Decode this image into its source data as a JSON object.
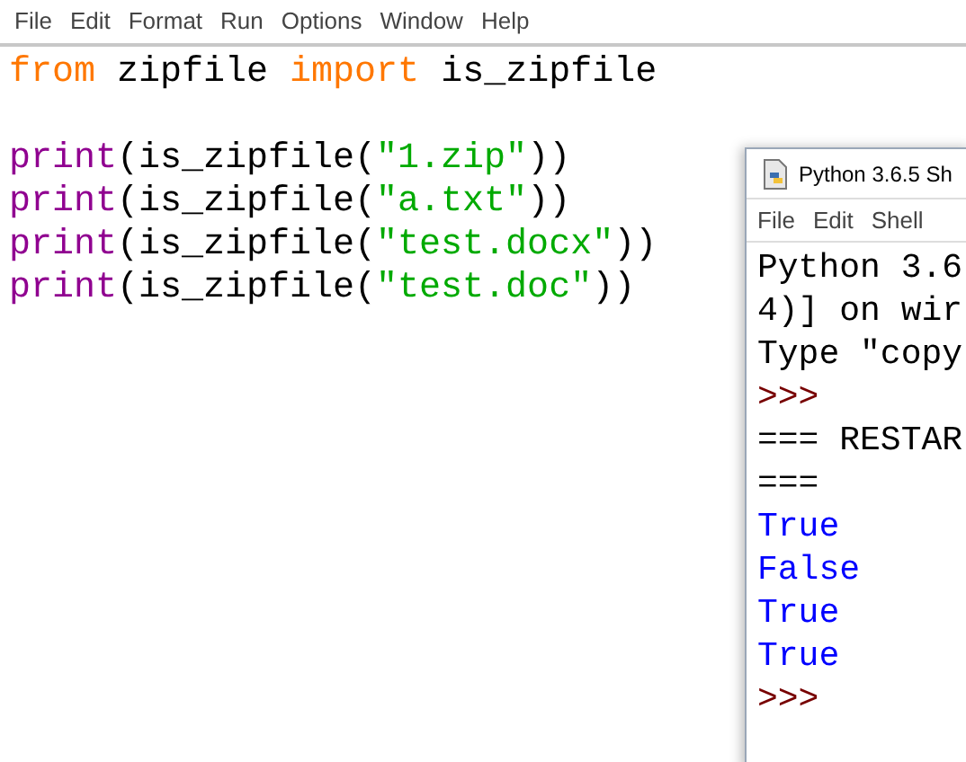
{
  "editor": {
    "menu": [
      "File",
      "Edit",
      "Format",
      "Run",
      "Options",
      "Window",
      "Help"
    ],
    "lines": [
      [
        {
          "kind": "keyword",
          "text": "from"
        },
        {
          "kind": "plain",
          "text": " zipfile "
        },
        {
          "kind": "keyword",
          "text": "import"
        },
        {
          "kind": "plain",
          "text": " is_zipfile"
        },
        {
          "kind": "blank_after"
        }
      ],
      [
        {
          "kind": "builtin",
          "text": "print"
        },
        {
          "kind": "plain",
          "text": "(is_zipfile("
        },
        {
          "kind": "string",
          "text": "\"1.zip\""
        },
        {
          "kind": "plain",
          "text": "))"
        }
      ],
      [
        {
          "kind": "builtin",
          "text": "print"
        },
        {
          "kind": "plain",
          "text": "(is_zipfile("
        },
        {
          "kind": "string",
          "text": "\"a.txt\""
        },
        {
          "kind": "plain",
          "text": "))"
        }
      ],
      [
        {
          "kind": "builtin",
          "text": "print"
        },
        {
          "kind": "plain",
          "text": "(is_zipfile("
        },
        {
          "kind": "string",
          "text": "\"test.docx\""
        },
        {
          "kind": "plain",
          "text": "))"
        }
      ],
      [
        {
          "kind": "builtin",
          "text": "print"
        },
        {
          "kind": "plain",
          "text": "(is_zipfile("
        },
        {
          "kind": "string",
          "text": "\"test.doc\""
        },
        {
          "kind": "plain",
          "text": "))"
        }
      ]
    ]
  },
  "shell": {
    "title": "Python 3.6.5 Sh",
    "menu": [
      "File",
      "Edit",
      "Shell"
    ],
    "lines": [
      {
        "kind": "plain",
        "text": "Python 3.6"
      },
      {
        "kind": "plain",
        "text": "4)] on wir"
      },
      {
        "kind": "plain",
        "text": "Type \"copy"
      },
      {
        "kind": "prompt",
        "text": ">>>"
      },
      {
        "kind": "plain",
        "text": "=== RESTAR"
      },
      {
        "kind": "plain",
        "text": "==="
      },
      {
        "kind": "output",
        "text": "True"
      },
      {
        "kind": "output",
        "text": "False"
      },
      {
        "kind": "output",
        "text": "True"
      },
      {
        "kind": "output",
        "text": "True"
      },
      {
        "kind": "prompt",
        "text": ">>>"
      }
    ]
  }
}
